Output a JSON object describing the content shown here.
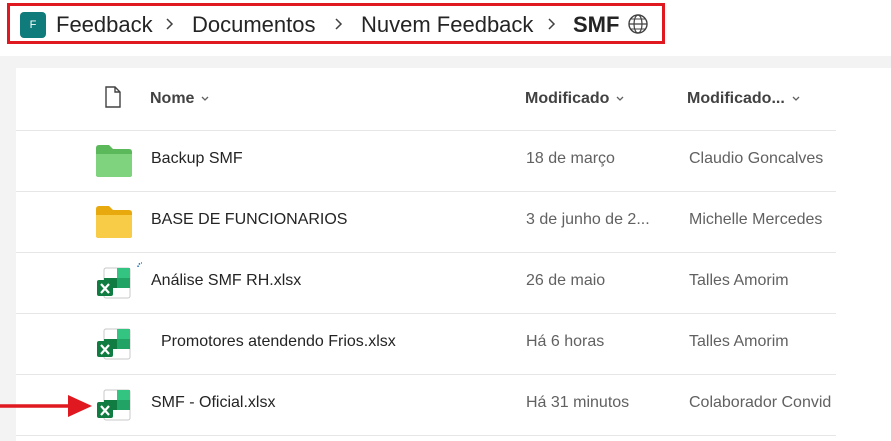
{
  "breadcrumb": {
    "site_initial": "F",
    "items": [
      "Feedback",
      "Documentos",
      "Nuvem Feedback",
      "SMF"
    ]
  },
  "columns": {
    "name": "Nome",
    "modified": "Modificado",
    "modified_by": "Modificado..."
  },
  "rows": [
    {
      "type": "folder",
      "color": "green",
      "name": "Backup SMF",
      "modified": "18 de março",
      "modified_by": "Claudio Goncalves"
    },
    {
      "type": "folder",
      "color": "yellow",
      "name": "BASE DE FUNCIONARIOS",
      "modified": "3 de junho de 2...",
      "modified_by": "Michelle Mercedes"
    },
    {
      "type": "excel",
      "name": "Análise SMF RH.xlsx",
      "modified": "26 de maio",
      "modified_by": "Talles Amorim"
    },
    {
      "type": "excel",
      "name": "Promotores atendendo Frios.xlsx",
      "modified": "Há 6 horas",
      "modified_by": "Talles Amorim"
    },
    {
      "type": "excel",
      "name": "SMF - Oficial.xlsx",
      "modified": "Há 31 minutos",
      "modified_by": "Colaborador Convid"
    }
  ],
  "colors": {
    "highlight": "#e0181f",
    "site_icon": "#0f7b7b",
    "excel_green": "#107c41",
    "folder_green": "#6cc96c",
    "folder_yellow": "#f6c23a"
  }
}
